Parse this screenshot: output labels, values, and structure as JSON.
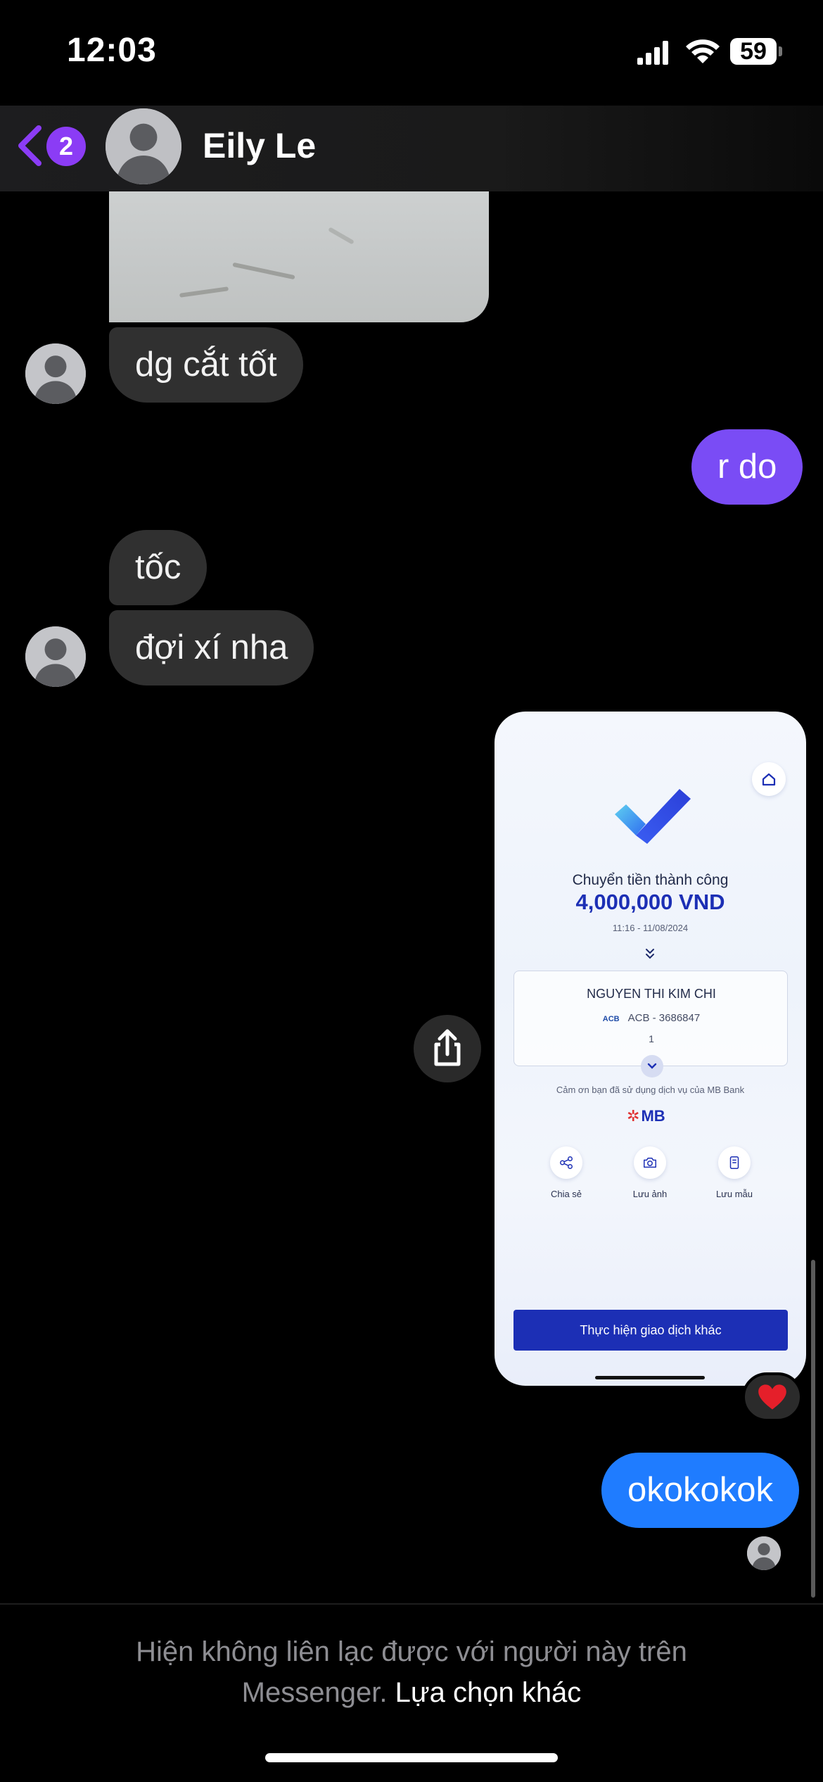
{
  "status_bar": {
    "time": "12:03",
    "battery": "59"
  },
  "header": {
    "back_badge": "2",
    "contact_name": "Eily Le"
  },
  "messages": [
    {
      "from": "them",
      "text": "dg cắt tốt"
    },
    {
      "from": "me",
      "text": "r do"
    },
    {
      "from": "them",
      "text": "tốc"
    },
    {
      "from": "them",
      "text": "đợi xí nha"
    },
    {
      "from": "me",
      "text": "okokokok"
    }
  ],
  "transfer_screenshot": {
    "title": "Chuyển tiền thành công",
    "amount": "4,000,000 VND",
    "datetime": "11:16 - 11/08/2024",
    "recipient_name": "NGUYEN THI KIM CHI",
    "bank_logo": "ACB",
    "account": "ACB - 3686847",
    "note": "1",
    "thanks": "Cảm ơn bạn đã sử dụng dịch vụ của MB Bank",
    "brand": "MB",
    "actions": [
      "Chia sẻ",
      "Lưu ảnh",
      "Lưu mẫu"
    ],
    "primary_button": "Thực hiện giao dịch khác"
  },
  "reaction": "heart",
  "footer": {
    "notice": "Hiện không liên lạc được với người này trên Messenger.",
    "link": "Lựa chọn khác"
  },
  "colors": {
    "accent_purple": "#7a4cf5",
    "bubble_blue": "#1f7cff",
    "incoming_bubble": "#303030"
  }
}
